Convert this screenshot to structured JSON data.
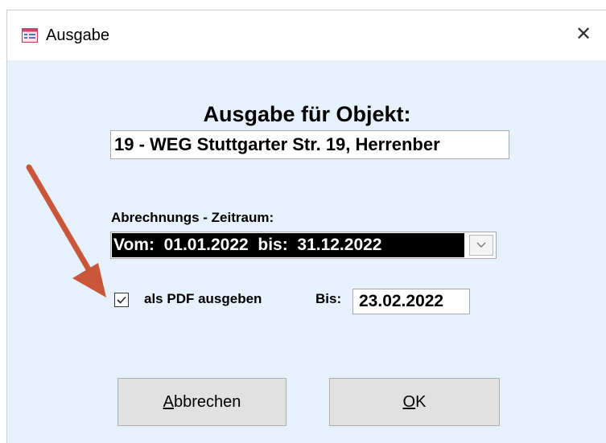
{
  "window": {
    "title": "Ausgabe",
    "close_glyph": "✕"
  },
  "form": {
    "heading": "Ausgabe für Objekt:",
    "objekt_value": "19 - WEG Stuttgarter Str. 19, Herrenber",
    "period_label": "Abrechnungs - Zeitraum:",
    "period_value": "Vom:  01.01.2022  bis:  31.12.2022",
    "pdf_checkbox_label": "als PDF ausgeben",
    "pdf_checked": true,
    "bis_label": "Bis:",
    "bis_value": "23.02.2022"
  },
  "buttons": {
    "cancel_label": "Abbrechen",
    "cancel_mnemonic": "A",
    "cancel_rest": "bbrechen",
    "ok_label": "OK",
    "ok_mnemonic": "O",
    "ok_rest": "K"
  },
  "colors": {
    "client_bg": "#e6f1fb",
    "arrow": "#c9553b",
    "selection_bg": "#000000"
  },
  "icons": {
    "app": "form-icon",
    "close": "close-icon",
    "dropdown": "chevron-down-icon",
    "check": "checkmark-icon",
    "annotation": "red-arrow"
  }
}
